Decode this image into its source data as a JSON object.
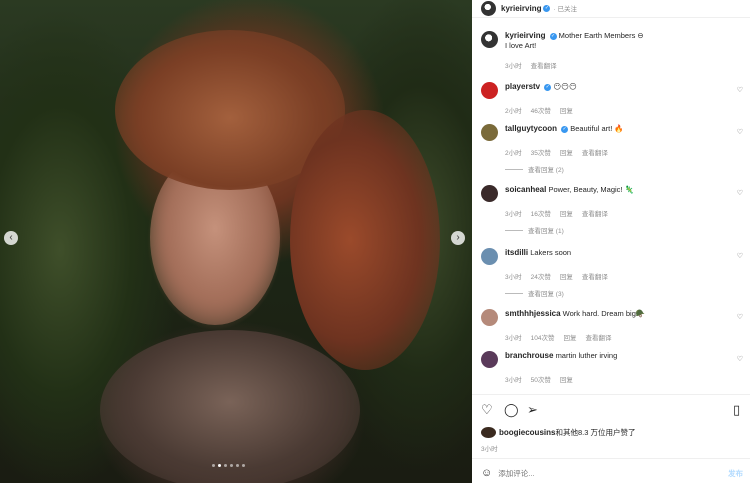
{
  "post": {
    "author": "kyrieirving",
    "follow_status": "· 已关注",
    "media_carousel": {
      "dots": 6,
      "active_dot": 1
    },
    "caption": {
      "username": "kyrieirving",
      "text": "Mother Earth Members ⊖",
      "line2": "I love Art!",
      "time": "3小时",
      "translate": "查看翻译"
    }
  },
  "comments": [
    {
      "username": "playerstv",
      "verified": true,
      "text": "😶😶😶",
      "time": "2小时",
      "likes": "46次赞",
      "reply": "回复",
      "translate": "",
      "view_replies": "",
      "avatar_color": "#cc2222"
    },
    {
      "username": "tallguytycoon",
      "verified": true,
      "text": "Beautiful art! 🔥",
      "time": "2小时",
      "likes": "35次赞",
      "reply": "回复",
      "translate": "查看翻译",
      "view_replies": "查看回复 (2)",
      "avatar_color": "#7a6a3a"
    },
    {
      "username": "soicanheal",
      "verified": false,
      "text": "Power, Beauty, Magic! 🦎",
      "time": "3小时",
      "likes": "16次赞",
      "reply": "回复",
      "translate": "查看翻译",
      "view_replies": "查看回复 (1)",
      "avatar_color": "#3a2a2a"
    },
    {
      "username": "itsdilli",
      "verified": false,
      "text": "Lakers soon",
      "time": "3小时",
      "likes": "24次赞",
      "reply": "回复",
      "translate": "查看翻译",
      "view_replies": "查看回复 (3)",
      "avatar_color": "#6b8fb0"
    },
    {
      "username": "smthhhjessica",
      "verified": false,
      "text": "Work hard. Dream big🪖",
      "time": "3小时",
      "likes": "104次赞",
      "reply": "回复",
      "translate": "查看翻译",
      "view_replies": "",
      "avatar_color": "#b58a7a"
    },
    {
      "username": "branchrouse",
      "verified": false,
      "text": "martin luther irving",
      "time": "3小时",
      "likes": "50次赞",
      "reply": "回复",
      "translate": "",
      "view_replies": "",
      "avatar_color": "#5a3a5a"
    }
  ],
  "likes_line": {
    "username": "boogiecousins",
    "text": "和其他8.3 万位用户赞了"
  },
  "time_ago": "3小时",
  "add_comment": {
    "placeholder": "添加评论...",
    "post_label": "发布"
  },
  "icons": [
    "heart-icon",
    "comment-icon",
    "share-icon",
    "bookmark-icon",
    "emoji-icon",
    "chevron-left-icon",
    "chevron-right-icon"
  ]
}
